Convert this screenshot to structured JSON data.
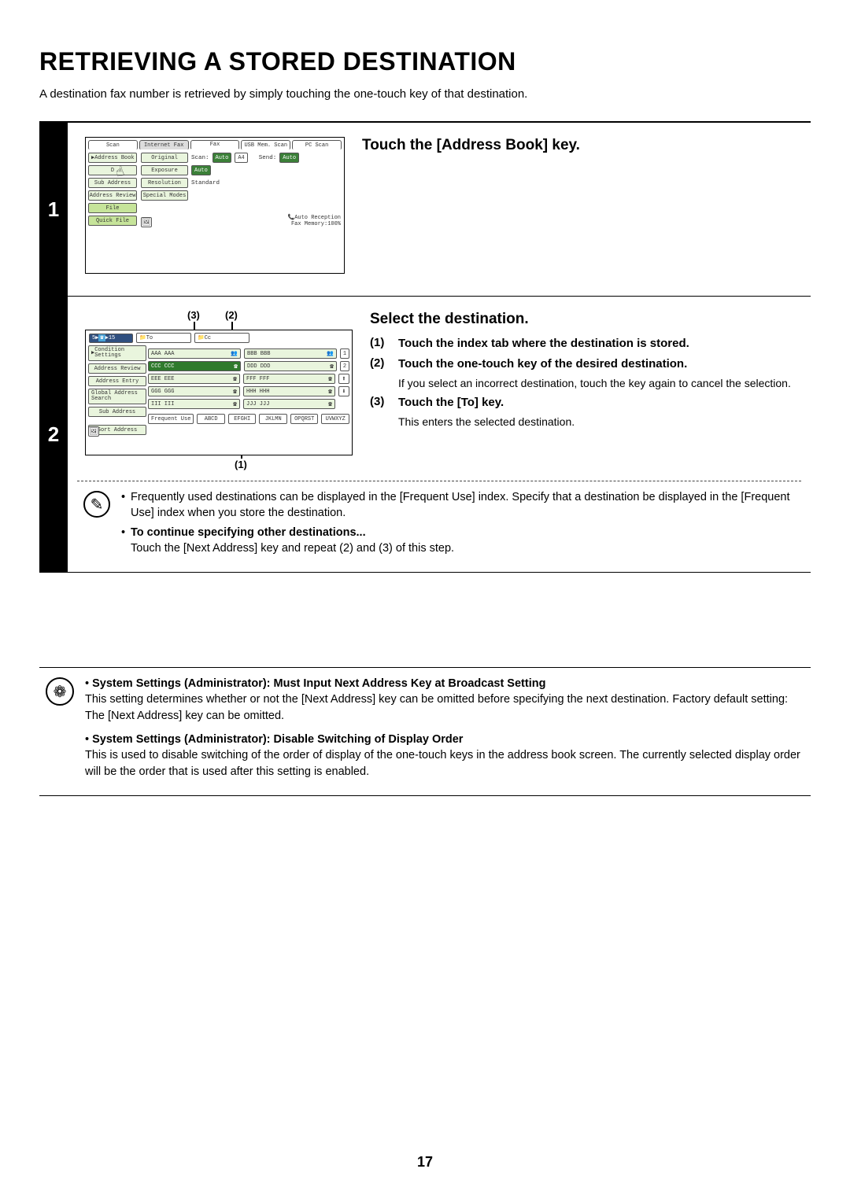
{
  "title": "RETRIEVING A STORED DESTINATION",
  "intro": "A destination fax number is retrieved by simply touching the one-touch key of that destination.",
  "page_number": "17",
  "step1": {
    "number": "1",
    "heading": "Touch the [Address Book] key.",
    "screen": {
      "tabs": [
        "Scan",
        "Internet Fax",
        "Fax",
        "USB Mem. Scan",
        "PC Scan"
      ],
      "side": [
        "Address Book",
        "D",
        "Sub Address",
        "Address Review",
        "File",
        "Quick File"
      ],
      "col2": [
        "Original",
        "Exposure",
        "Resolution",
        "Special Modes"
      ],
      "scan_label": "Scan:",
      "auto1": "Auto",
      "a4": "A4",
      "send_label": "Send:",
      "auto2": "Auto",
      "auto3": "Auto",
      "standard": "Standard",
      "footer1": "Auto Reception",
      "footer2": "Fax Memory:100%"
    }
  },
  "step2": {
    "number": "2",
    "heading": "Select the destination.",
    "callouts": {
      "c1": "(1)",
      "c2": "(2)",
      "c3": "(3)"
    },
    "screen": {
      "crumb_pre": "5",
      "crumb_post": "15",
      "to": "To",
      "cc": "Cc",
      "side": [
        "Condition Settings",
        "Address Review",
        "Address Entry",
        "Global Address Search",
        "Sub Address",
        "Sort Address"
      ],
      "entries_left": [
        "AAA AAA",
        "CCC CCC",
        "EEE EEE",
        "GGG GGG",
        "III III"
      ],
      "entries_right": [
        "BBB BBB",
        "DDD DDD",
        "FFF FFF",
        "HHH HHH",
        "JJJ JJJ"
      ],
      "nums": [
        "1",
        "2"
      ],
      "index_tabs": [
        "Frequent Use",
        "ABCD",
        "EFGHI",
        "JKLMN",
        "OPQRST",
        "UVWXYZ"
      ]
    },
    "substeps": [
      {
        "num": "(1)",
        "bold": "Touch the index tab where the destination is stored."
      },
      {
        "num": "(2)",
        "bold": "Touch the one-touch key of the desired destination.",
        "note": "If you select an incorrect destination, touch the key again to cancel the selection."
      },
      {
        "num": "(3)",
        "bold": "Touch the [To] key.",
        "note": "This enters the selected destination."
      }
    ],
    "notes": {
      "n1": "Frequently used destinations can be displayed in the [Frequent Use] index. Specify that a destination be displayed in the [Frequent Use] index when you store the destination.",
      "n2_head": "To continue specifying other destinations...",
      "n2_body": "Touch the [Next Address] key and repeat (2) and (3) of this step."
    }
  },
  "system_settings": [
    {
      "head": "System Settings (Administrator): Must Input Next Address Key at Broadcast Setting",
      "desc": "This setting determines whether or not the [Next Address] key can be omitted before specifying the next destination. Factory default setting: The [Next Address] key can be omitted."
    },
    {
      "head": "System Settings (Administrator): Disable Switching of Display Order",
      "desc": "This is used to disable switching of the order of display of the one-touch keys in the address book screen. The currently selected display order will be the order that is used after this setting is enabled."
    }
  ]
}
